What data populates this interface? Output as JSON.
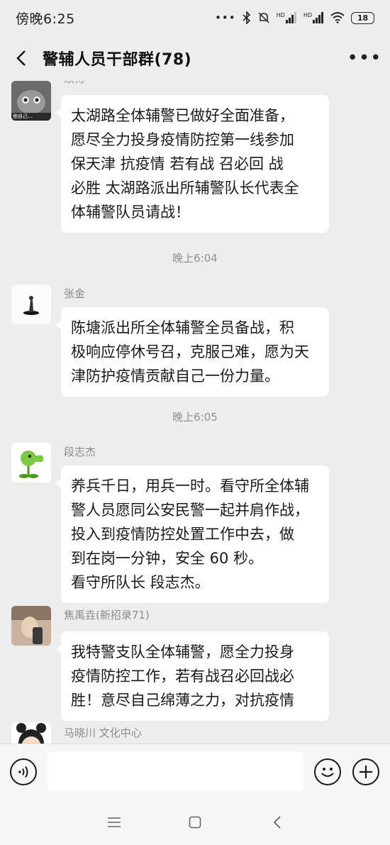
{
  "status_bar": {
    "time": "傍晚6:25",
    "battery": "18",
    "signal_labels": [
      "HD",
      "HD"
    ]
  },
  "header": {
    "title": "警辅人员干部群(78)"
  },
  "messages": [
    {
      "sender": "续博",
      "lines": [
        "太湖路全体辅警已做好全面准备，",
        "愿尽全力投身疫情防控第一线参加",
        "保天津  抗疫情  若有战 召必回 战",
        "必胜  太湖路派出所辅警队长代表全",
        "体辅警队员请战！"
      ],
      "avatar_caption": "他自己…"
    },
    {
      "sender": "张金",
      "lines": [
        "陈塘派出所全体辅警全员备战，积",
        "极响应停休号召，克服己难，愿为天",
        "津防护疫情贡献自己一份力量。"
      ]
    },
    {
      "sender": "段志杰",
      "lines": [
        "养兵千日，用兵一时。看守所全体辅",
        "警人员愿同公安民警一起并肩作战，",
        "投入到疫情防控处置工作中去，做",
        "到在岗一分钟，安全 60 秒。",
        "看守所队长      段志杰。"
      ]
    },
    {
      "sender": "焦禹垚(新招录71)",
      "lines": [
        "我特警支队全体辅警，愿全力投身",
        "疫情防控工作，若有战召必回战必",
        "胜！意尽自己绵薄之力，对抗疫情"
      ]
    },
    {
      "sender": "马晓川 文化中心",
      "lines": []
    }
  ],
  "timestamps": [
    "晚上6:04",
    "晚上6:05"
  ],
  "input": {
    "value": "",
    "placeholder": ""
  },
  "colors": {
    "background": "#ededed",
    "bubble": "#ffffff",
    "meta_text": "#8a8a8a",
    "bar": "#f6f6f6"
  }
}
